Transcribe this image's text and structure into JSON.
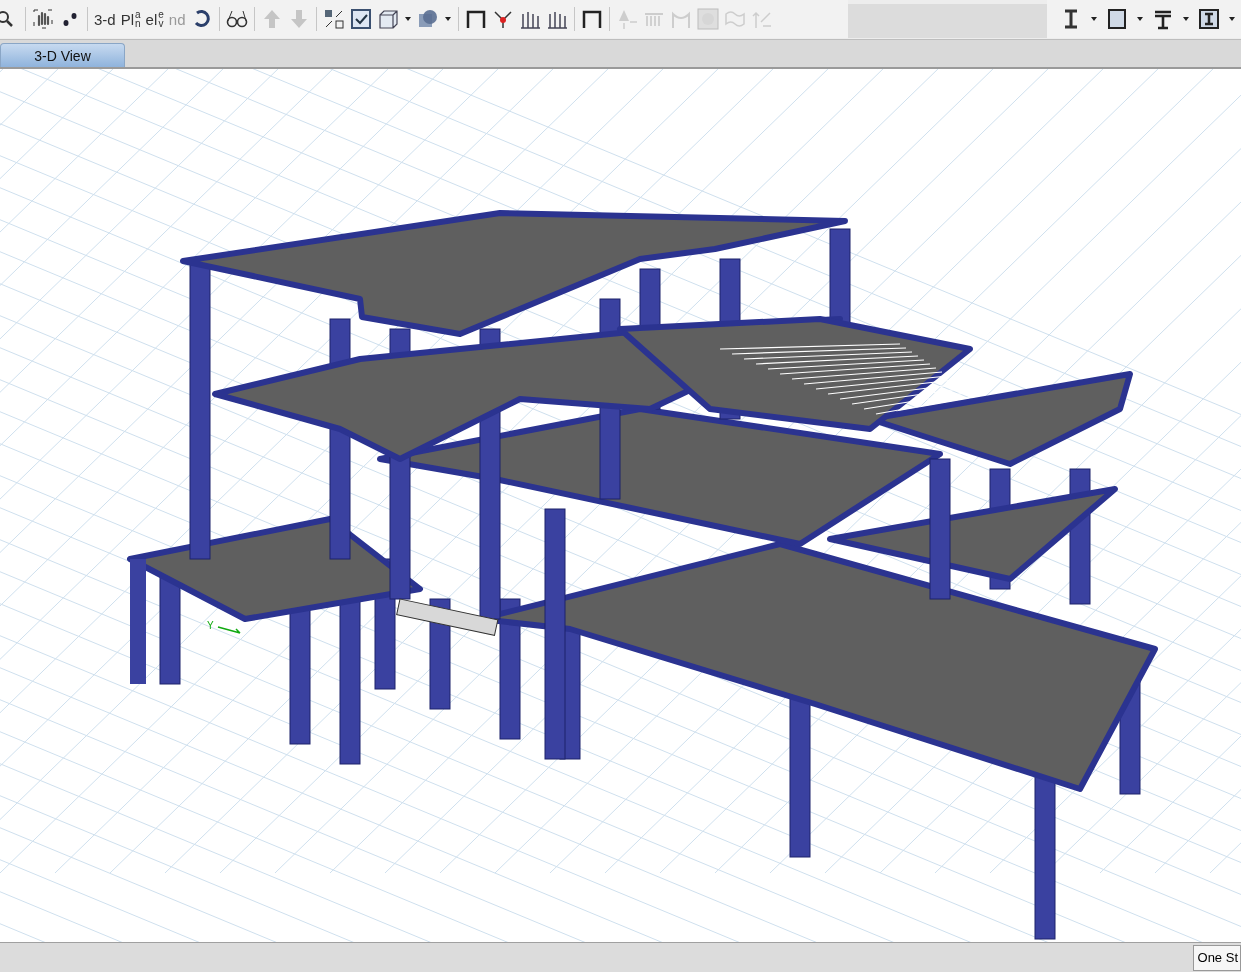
{
  "toolbar": {
    "left": [
      {
        "kind": "zoom",
        "disabled": false
      },
      {
        "kind": "sep"
      },
      {
        "kind": "pan",
        "disabled": false
      },
      {
        "kind": "dots",
        "disabled": false
      },
      {
        "kind": "sep"
      },
      {
        "kind": "text",
        "label": "3-d",
        "disabled": false
      },
      {
        "kind": "stack",
        "label": "Pl",
        "top": "a",
        "bottom": "n",
        "disabled": false
      },
      {
        "kind": "stack",
        "label": "el",
        "top": "e",
        "bottom": "v",
        "disabled": false
      },
      {
        "kind": "text",
        "label": "nd",
        "disabled": true
      },
      {
        "kind": "rotate",
        "disabled": false
      },
      {
        "kind": "sep"
      },
      {
        "kind": "glasses",
        "disabled": false
      },
      {
        "kind": "sep"
      },
      {
        "kind": "up",
        "disabled": true
      },
      {
        "kind": "down",
        "disabled": true
      },
      {
        "kind": "sep"
      },
      {
        "kind": "shrink",
        "disabled": false
      },
      {
        "kind": "check",
        "disabled": false
      },
      {
        "kind": "cube",
        "disabled": false
      },
      {
        "kind": "caret"
      },
      {
        "kind": "sphere",
        "disabled": false
      },
      {
        "kind": "caret"
      },
      {
        "kind": "sep"
      },
      {
        "kind": "frame",
        "disabled": false
      },
      {
        "kind": "joint",
        "disabled": false
      },
      {
        "kind": "bars",
        "disabled": false
      },
      {
        "kind": "bars",
        "disabled": false
      },
      {
        "kind": "sep"
      },
      {
        "kind": "frame",
        "disabled": false
      },
      {
        "kind": "sep"
      },
      {
        "kind": "cone",
        "disabled": true
      },
      {
        "kind": "spring",
        "disabled": true
      },
      {
        "kind": "deform",
        "disabled": true
      },
      {
        "kind": "contour",
        "disabled": true
      },
      {
        "kind": "wave",
        "disabled": true
      },
      {
        "kind": "arrows",
        "disabled": true
      }
    ],
    "right": [
      {
        "kind": "ibeam",
        "disabled": false
      },
      {
        "kind": "caret"
      },
      {
        "kind": "boxsec",
        "disabled": false
      },
      {
        "kind": "caret"
      },
      {
        "kind": "tbeam",
        "disabled": false
      },
      {
        "kind": "caret"
      },
      {
        "kind": "ibox",
        "disabled": false
      },
      {
        "kind": "caret"
      }
    ]
  },
  "tabs": [
    {
      "label": "3-D View",
      "selected": true
    }
  ],
  "view": {
    "axis_label": "Y"
  },
  "status_bar": {
    "field": "One St"
  }
}
